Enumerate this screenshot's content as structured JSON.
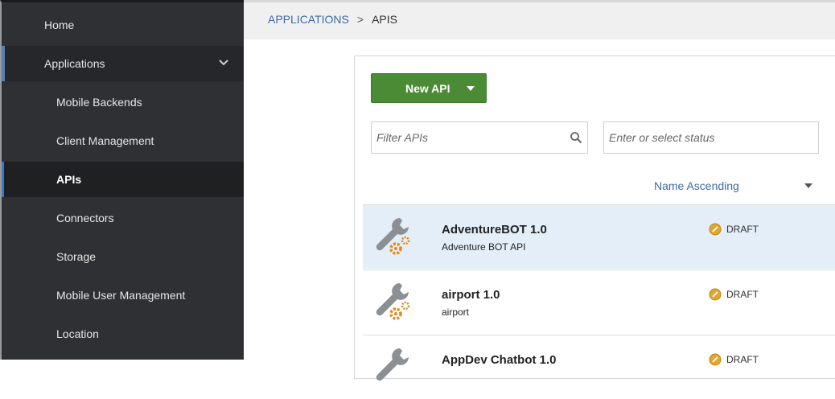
{
  "sidebar": {
    "items": [
      {
        "label": "Home"
      },
      {
        "label": "Applications"
      },
      {
        "label": "Mobile Backends"
      },
      {
        "label": "Client Management"
      },
      {
        "label": "APIs"
      },
      {
        "label": "Connectors"
      },
      {
        "label": "Storage"
      },
      {
        "label": "Mobile User Management"
      },
      {
        "label": "Location"
      }
    ]
  },
  "breadcrumb": {
    "parent": "APPLICATIONS",
    "separator": ">",
    "current": "APIS"
  },
  "toolbar": {
    "new_api_label": "New API"
  },
  "filters": {
    "filter_placeholder": "Filter APIs",
    "status_placeholder": "Enter or select status"
  },
  "sort": {
    "label": "Name Ascending"
  },
  "apis": [
    {
      "name": "AdventureBOT 1.0",
      "description": "Adventure BOT API",
      "status": "DRAFT"
    },
    {
      "name": "airport 1.0",
      "description": "airport",
      "status": "DRAFT"
    },
    {
      "name": "AppDev Chatbot 1.0",
      "description": "",
      "status": "DRAFT"
    }
  ],
  "colors": {
    "sidebar_bg": "#2f3033",
    "accent": "#3d6aa3",
    "primary_button": "#4b8b36",
    "selected_row": "#e4eef8",
    "draft_badge": "#e0a82e"
  }
}
